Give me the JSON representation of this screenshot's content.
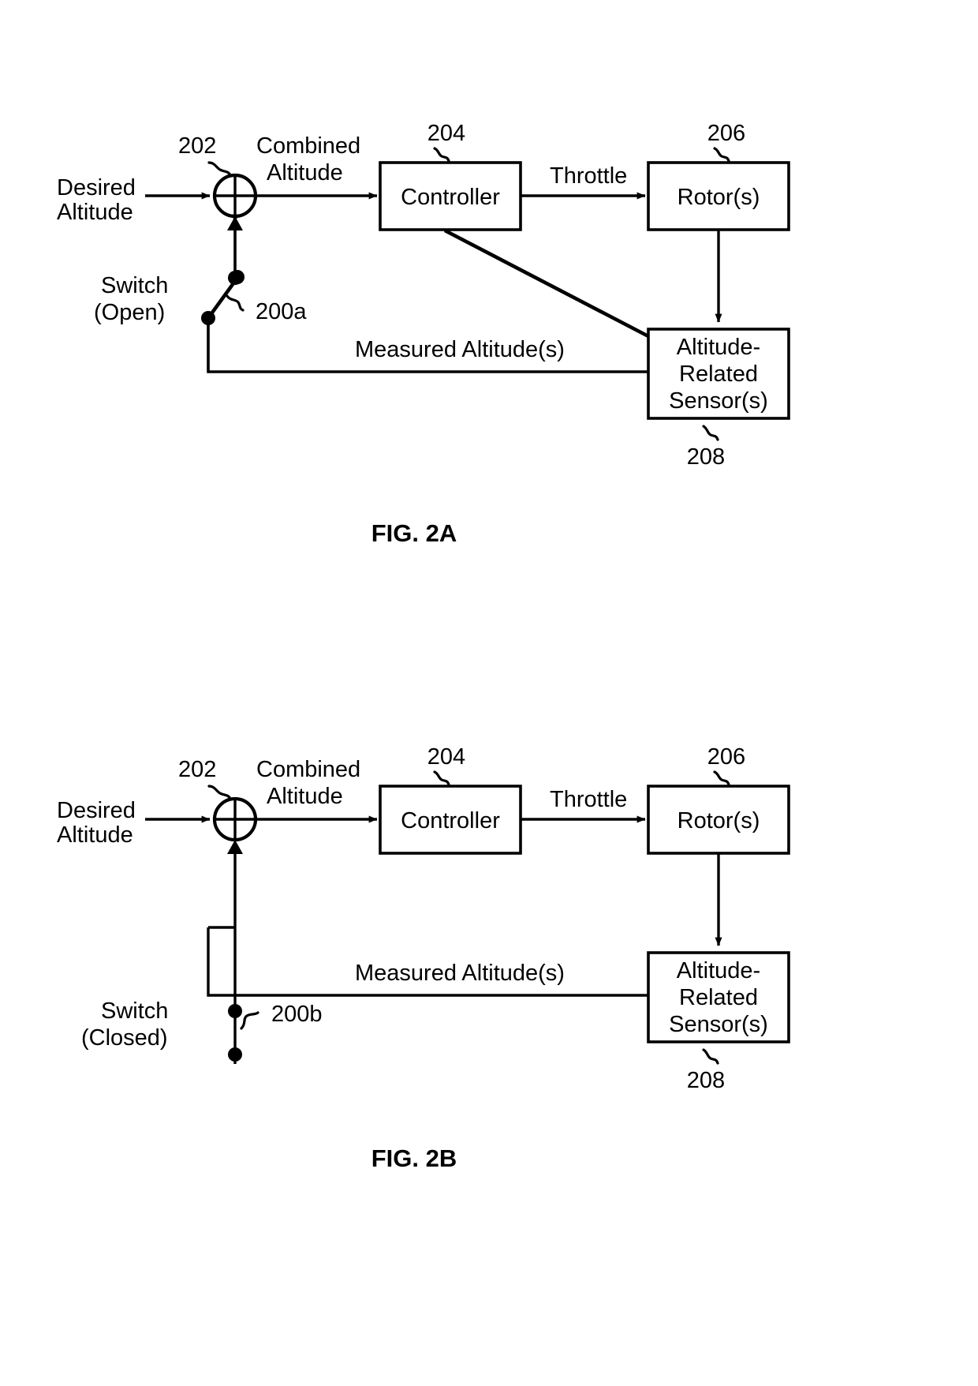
{
  "document": {
    "type": "patent-figure-sheet",
    "background_color": "#ffffff",
    "line_color": "#000000"
  },
  "figures": [
    {
      "id": "fig-2a",
      "caption": "FIG. 2A",
      "switch_state": "open",
      "blocks": [
        {
          "id": "controller",
          "label": "Controller",
          "ref": "204"
        },
        {
          "id": "rotors",
          "label": "Rotor(s)",
          "ref": "206"
        },
        {
          "id": "sensors",
          "label_line1": "Altitude-",
          "label_line2": "Related",
          "label_line3": "Sensor(s)",
          "ref": "208"
        }
      ],
      "junction": {
        "id": "summing-junction",
        "ref": "202"
      },
      "switch": {
        "id": "switch-200a",
        "ref": "200a",
        "label_line1": "Switch",
        "label_line2": "(Open)"
      },
      "signals": {
        "input_line1": "Desired",
        "input_line2": "Altitude",
        "combined_line1": "Combined",
        "combined_line2": "Altitude",
        "throttle": "Throttle",
        "feedback": "Measured Altitude(s)"
      }
    },
    {
      "id": "fig-2b",
      "caption": "FIG. 2B",
      "switch_state": "closed",
      "blocks": [
        {
          "id": "controller",
          "label": "Controller",
          "ref": "204"
        },
        {
          "id": "rotors",
          "label": "Rotor(s)",
          "ref": "206"
        },
        {
          "id": "sensors",
          "label_line1": "Altitude-",
          "label_line2": "Related",
          "label_line3": "Sensor(s)",
          "ref": "208"
        }
      ],
      "junction": {
        "id": "summing-junction",
        "ref": "202"
      },
      "switch": {
        "id": "switch-200b",
        "ref": "200b",
        "label_line1": "Switch",
        "label_line2": "(Closed)"
      },
      "signals": {
        "input_line1": "Desired",
        "input_line2": "Altitude",
        "combined_line1": "Combined",
        "combined_line2": "Altitude",
        "throttle": "Throttle",
        "feedback": "Measured Altitude(s)"
      }
    }
  ]
}
